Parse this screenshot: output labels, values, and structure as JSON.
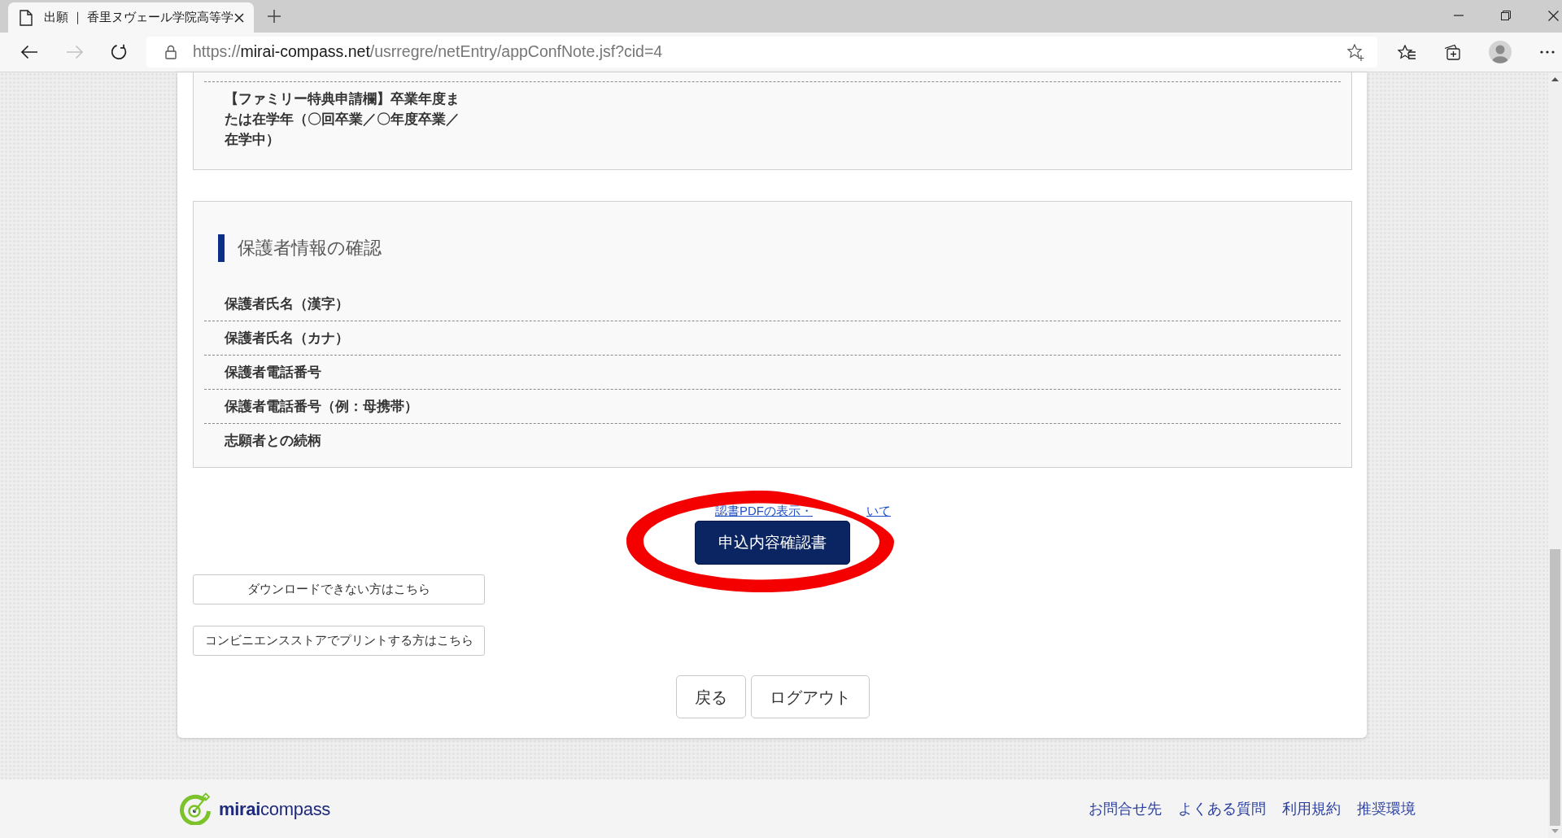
{
  "browser": {
    "tabs": [
      {
        "title": "出願 ｜ 香里ヌヴェール学院高等学",
        "selected": true
      }
    ],
    "nav_buttons": [
      {
        "kind": "back",
        "disabled": false
      },
      {
        "kind": "forward",
        "disabled": true
      },
      {
        "kind": "refresh",
        "disabled": false
      }
    ],
    "address": {
      "scheme": "https://",
      "host": "mirai-compass.net",
      "path": "/usrregre/netEntry/appConfNote.jsf?cid=4"
    }
  },
  "sections": [
    {
      "kind": "continued",
      "rows": [
        {
          "label": "【ファミリー特典申請欄】卒業年度または在学年（〇回卒業／〇年度卒業／在学中）"
        }
      ]
    },
    {
      "kind": "titled",
      "title": "保護者情報の確認",
      "rows": [
        {
          "label": "保護者氏名（漢字）"
        },
        {
          "label": "保護者氏名（カナ）"
        },
        {
          "label": "保護者電話番号"
        },
        {
          "label": "保護者電話番号（例：母携帯）"
        },
        {
          "label": "志願者との続柄"
        }
      ]
    }
  ],
  "pdf_link_parts": [
    "認書PDFの表示・",
    "いて"
  ],
  "confirm_button": "申込内容確認書",
  "help_buttons": [
    "ダウンロードできない方はこちら",
    "コンビニエンスストアでプリントする方はこちら"
  ],
  "page_buttons": [
    "戻る",
    "ログアウト"
  ],
  "footer": {
    "logo": "**mirai**compass",
    "links": [
      "お問合せ先",
      "よくある質問",
      "利用規約",
      "推奨環境"
    ]
  }
}
